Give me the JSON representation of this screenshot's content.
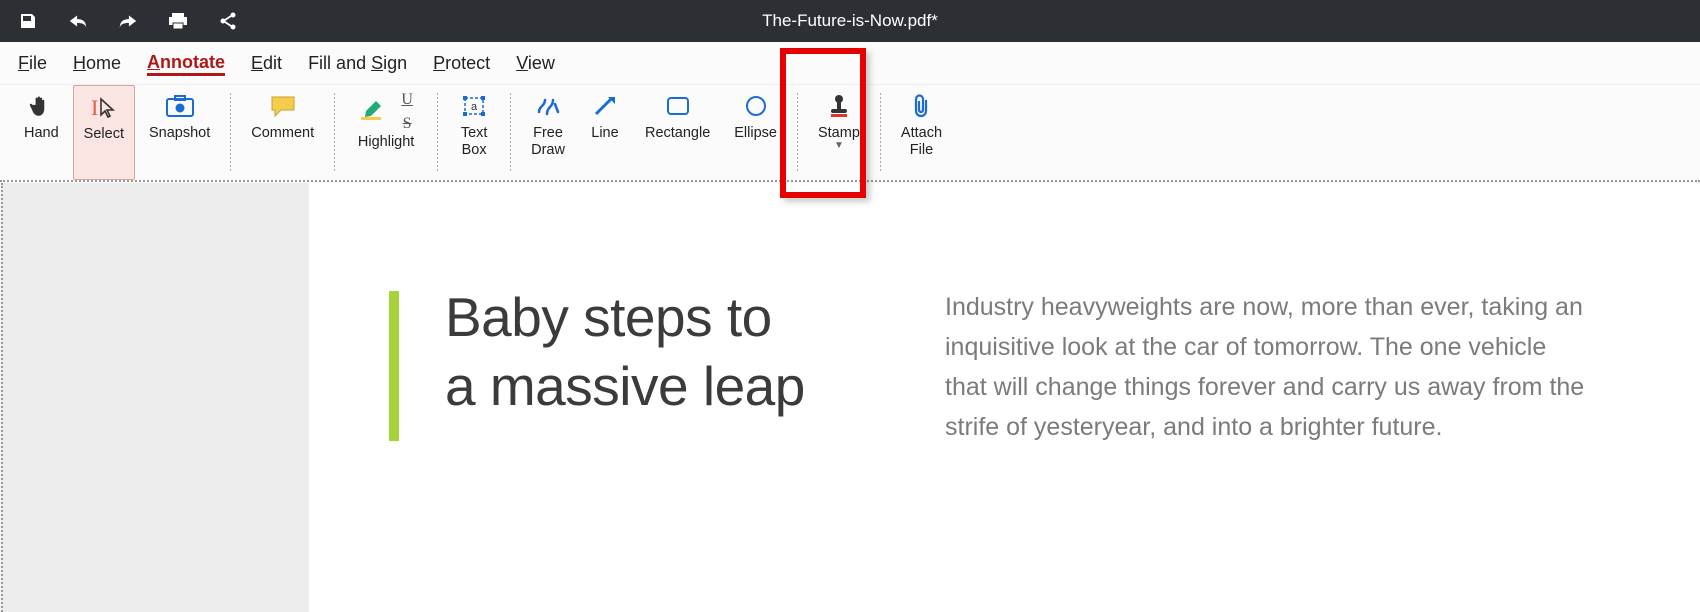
{
  "titlebar": {
    "title": "The-Future-is-Now.pdf*"
  },
  "menubar": {
    "file": "File",
    "home": "Home",
    "annotate": "Annotate",
    "edit": "Edit",
    "fill_sign": "Fill and Sign",
    "protect": "Protect",
    "view": "View",
    "active": "Annotate"
  },
  "ribbon": {
    "hand": "Hand",
    "select": "Select",
    "snapshot": "Snapshot",
    "comment": "Comment",
    "highlight": "Highlight",
    "textbox_l1": "Text",
    "textbox_l2": "Box",
    "freedraw_l1": "Free",
    "freedraw_l2": "Draw",
    "line": "Line",
    "rectangle": "Rectangle",
    "ellipse": "Ellipse",
    "stamp": "Stamp",
    "attach_l1": "Attach",
    "attach_l2": "File"
  },
  "document": {
    "headline_l1": "Baby steps to",
    "headline_l2": "a massive leap",
    "body": "Industry heavyweights are now, more than ever, taking an inquisitive look at the car of tomorrow. The one vehicle that will change things forever and carry us away from the strife of yesteryear, and into a brighter future."
  }
}
